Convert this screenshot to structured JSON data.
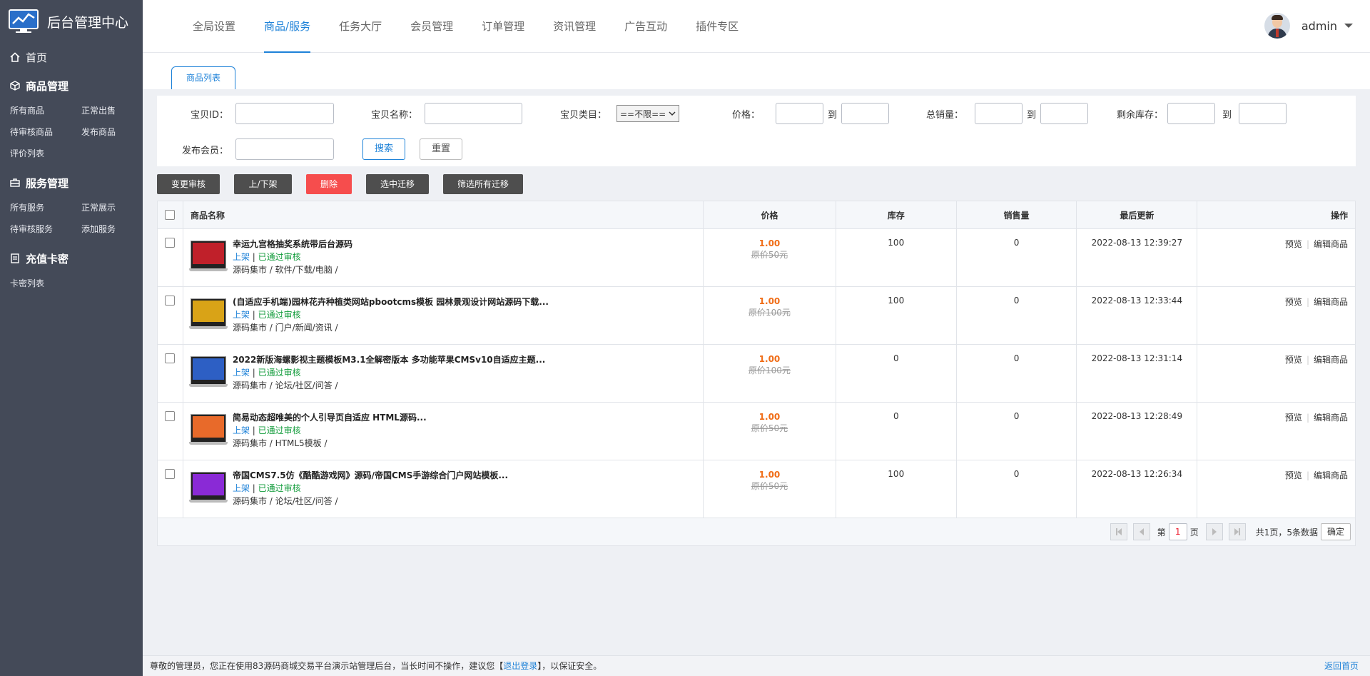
{
  "app": {
    "title": "后台管理中心"
  },
  "sidebar": {
    "home": "首页",
    "groups": [
      {
        "title": "商品管理",
        "items": [
          "所有商品",
          "正常出售",
          "待审核商品",
          "发布商品",
          "评价列表"
        ]
      },
      {
        "title": "服务管理",
        "items": [
          "所有服务",
          "正常展示",
          "待审核服务",
          "添加服务"
        ]
      },
      {
        "title": "充值卡密",
        "items": [
          "卡密列表"
        ]
      }
    ]
  },
  "topnav": {
    "tabs": [
      "全局设置",
      "商品/服务",
      "任务大厅",
      "会员管理",
      "订单管理",
      "资讯管理",
      "广告互动",
      "插件专区"
    ],
    "active_tab": "商品/服务",
    "user": "admin"
  },
  "subtab": "商品列表",
  "search": {
    "id_label": "宝贝ID：",
    "name_label": "宝贝名称：",
    "category_label": "宝贝类目：",
    "category_value": "==不限==",
    "price_label": "价格：",
    "to": "到",
    "sales_label": "总销量：",
    "stock_label": "剩余库存：",
    "member_label": "发布会员：",
    "search_button": "搜索",
    "reset_button": "重置"
  },
  "actions": [
    "变更审核",
    "上/下架",
    "删除",
    "选中迁移",
    "筛选所有迁移"
  ],
  "table": {
    "headers": [
      "商品名称",
      "价格",
      "库存",
      "销售量",
      "最后更新",
      "操作"
    ],
    "rows": [
      {
        "name": "幸运九宫格抽奖系统带后台源码",
        "status_on": "上架",
        "status_ok": "已通过审核",
        "category": "源码集市 / 软件/下载/电脑 /",
        "price": "1.00",
        "original": "原价50元",
        "stock": "100",
        "sales": "0",
        "updated": "2022-08-13 12:39:27",
        "thumb_color": "#c0202a"
      },
      {
        "name": "(自适应手机端)园林花卉种植类网站pbootcms模板 园林景观设计网站源码下载...",
        "status_on": "上架",
        "status_ok": "已通过审核",
        "category": "源码集市 / 门户/新闻/资讯 /",
        "price": "1.00",
        "original": "原价100元",
        "stock": "100",
        "sales": "0",
        "updated": "2022-08-13 12:33:44",
        "thumb_color": "#d9a317"
      },
      {
        "name": "2022新版海螺影视主题模板M3.1全解密版本 多功能苹果CMSv10自适应主题...",
        "status_on": "上架",
        "status_ok": "已通过审核",
        "category": "源码集市 / 论坛/社区/问答 /",
        "price": "1.00",
        "original": "原价100元",
        "stock": "0",
        "sales": "0",
        "updated": "2022-08-13 12:31:14",
        "thumb_color": "#2d5fc4"
      },
      {
        "name": "简易动态超唯美的个人引导页自适应 HTML源码...",
        "status_on": "上架",
        "status_ok": "已通过审核",
        "category": "源码集市 / HTML5模板 /",
        "price": "1.00",
        "original": "原价50元",
        "stock": "0",
        "sales": "0",
        "updated": "2022-08-13 12:28:49",
        "thumb_color": "#e86a2a"
      },
      {
        "name": "帝国CMS7.5仿《酷酷游戏网》源码/帝国CMS手游综合门户网站模板...",
        "status_on": "上架",
        "status_ok": "已通过审核",
        "category": "源码集市 / 论坛/社区/问答 /",
        "price": "1.00",
        "original": "原价50元",
        "stock": "100",
        "sales": "0",
        "updated": "2022-08-13 12:26:34",
        "thumb_color": "#8a2ad6"
      }
    ],
    "op_preview": "预览",
    "op_edit": "编辑商品"
  },
  "pager": {
    "page_prefix": "第",
    "page": "1",
    "page_suffix": "页",
    "summary": "共1页，5条数据",
    "confirm": "确定"
  },
  "footer": {
    "text_before": "尊敬的管理员，您正在使用83源码商城交易平台演示站管理后台，当长时间不操作，建议您【",
    "logout": "退出登录",
    "text_after": "】，以保证安全。",
    "home_link": "返回首页"
  },
  "colors": {
    "accent": "#1e82d8",
    "sidebar": "#444a58",
    "danger": "#f64d4d",
    "price": "#f06d17",
    "approved": "#139c3c"
  }
}
